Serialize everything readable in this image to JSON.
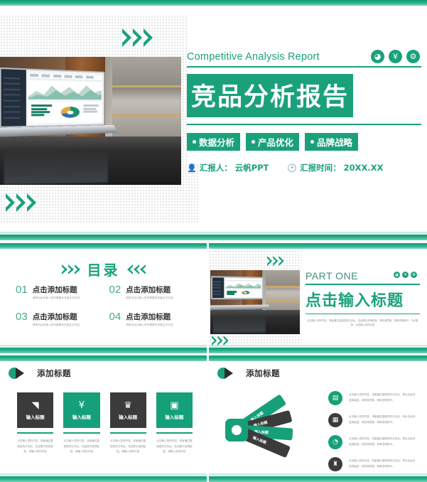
{
  "slide1": {
    "english_title": "Competitive Analysis Report",
    "chinese_title": "竞品分析报告",
    "icons": [
      "chart-icon",
      "yen-icon",
      "link-icon"
    ],
    "tags": [
      "数据分析",
      "产品优化",
      "品牌战略"
    ],
    "presenter_label": "汇报人：",
    "presenter_value": "云帆PPT",
    "date_label": "汇报时间：",
    "date_value": "20XX.XX"
  },
  "slide2": {
    "title": "目录",
    "items": [
      {
        "num": "01",
        "title": "点击添加标题",
        "subtitle": "请单击此处输入您所需要的详细文字内容"
      },
      {
        "num": "02",
        "title": "点击添加标题",
        "subtitle": "请单击此处输入您所需要的详细文字内容"
      },
      {
        "num": "03",
        "title": "点击添加标题",
        "subtitle": "请单击此处输入您所需要的详细文字内容"
      },
      {
        "num": "04",
        "title": "点击添加标题",
        "subtitle": "请单击此处输入您所需要的详细文字内容"
      }
    ]
  },
  "slide3": {
    "part_label": "PART ONE",
    "title": "点击输入标题",
    "body": "点击输入您的内容，或者通过复制您的文本后，在此框中选择粘贴，请言简意赅，简单说明即可，不必繁琐，点击输入您的内容"
  },
  "slide4": {
    "section_title": "添加标题",
    "cards": [
      {
        "icon": "target-chart-icon",
        "glyph": "◥",
        "label": "输入标题",
        "style": "dark",
        "desc": "点击输入您的内容，或者通过复制您的文本后，在此框中选择粘贴，请输入您的内容"
      },
      {
        "icon": "yen-icon",
        "glyph": "¥",
        "label": "输入标题",
        "style": "green",
        "desc": "点击输入您的内容，或者通过复制您的文本后，在此框中选择粘贴，请输入您的内容"
      },
      {
        "icon": "people-group-icon",
        "glyph": "♛",
        "label": "输入标题",
        "style": "dark",
        "desc": "点击输入您的内容，或者通过复制您的文本后，在此框中选择粘贴，请输入您的内容"
      },
      {
        "icon": "calculator-icon",
        "glyph": "▣",
        "label": "输入标题",
        "style": "green",
        "desc": "点击输入您的内容，或者通过复制您的文本后，在此框中选择粘贴，请输入您的内容"
      }
    ]
  },
  "slide5": {
    "section_title": "添加标题",
    "blades": [
      {
        "label": "输入标题",
        "style": "green"
      },
      {
        "label": "输入标题",
        "style": "dark"
      },
      {
        "label": "输入标题",
        "style": "green"
      },
      {
        "label": "输入标题",
        "style": "dark"
      }
    ],
    "rows": [
      {
        "icon": "presentation-icon",
        "glyph": "▤",
        "style": "green",
        "text": "点击输入您的内容，或者通过复制您的文本后，再点击此处选择粘贴，请言简意赅，简单说明即可。"
      },
      {
        "icon": "document-icon",
        "glyph": "▦",
        "style": "dark",
        "text": "点击输入您的内容，或者通过复制您的文本后，再点击此处选择粘贴，请言简意赅，简单说明即可。"
      },
      {
        "icon": "clock-icon",
        "glyph": "◔",
        "style": "green",
        "text": "点击输入您的内容，或者通过复制您的文本后，再点击此处选择粘贴，请言简意赅，简单说明即可。"
      },
      {
        "icon": "trophy-icon",
        "glyph": "♜",
        "style": "dark",
        "text": "点击输入您的内容，或者通过复制您的文本后，再点击此处选择粘贴，请言简意赅，简单说明即可。"
      }
    ]
  },
  "theme": {
    "accent": "#1aa17c",
    "dark": "#3b3b3b"
  }
}
